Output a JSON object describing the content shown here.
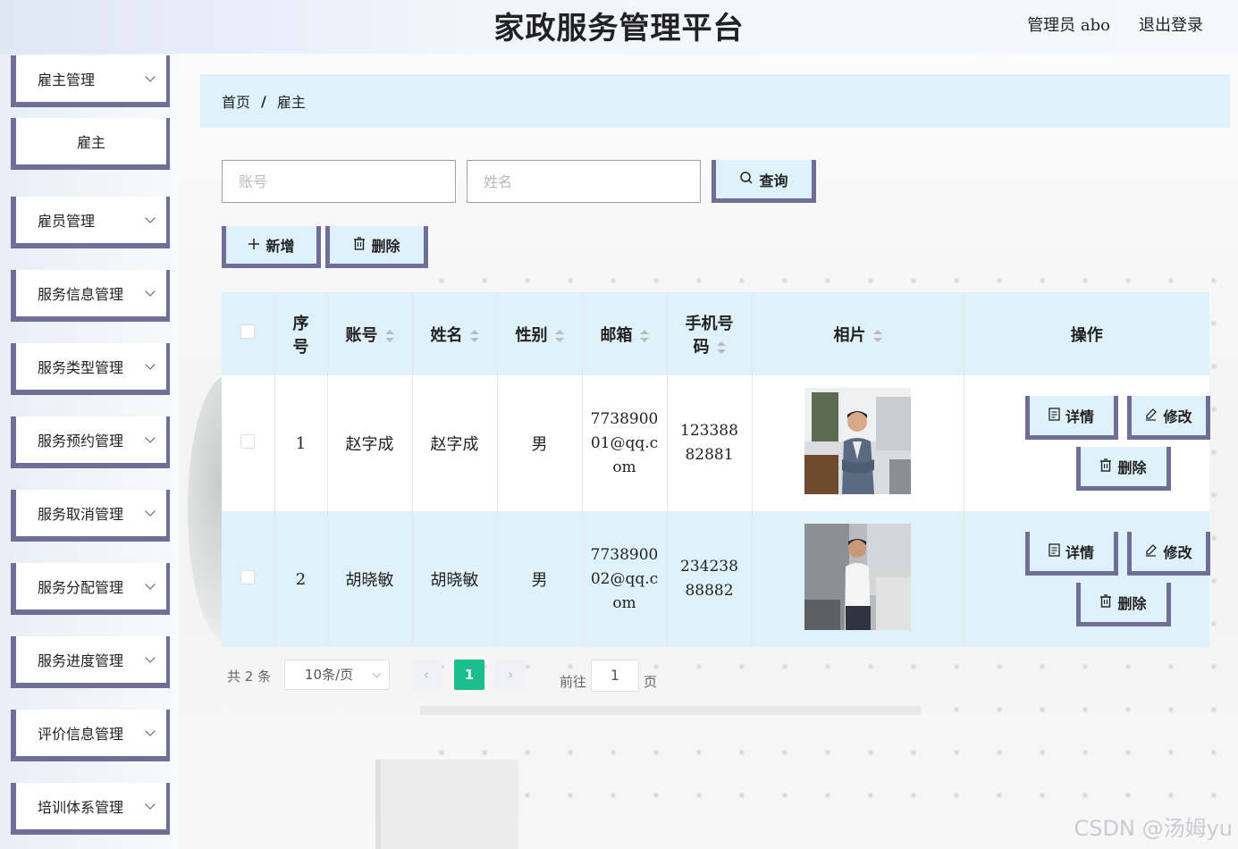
{
  "header": {
    "title": "家政服务管理平台",
    "admin": "管理员 abo",
    "logout": "退出登录"
  },
  "sidebar": {
    "items": [
      {
        "label": "雇主管理"
      },
      {
        "label": "雇主"
      },
      {
        "label": "雇员管理"
      },
      {
        "label": "服务信息管理"
      },
      {
        "label": "服务类型管理"
      },
      {
        "label": "服务预约管理"
      },
      {
        "label": "服务取消管理"
      },
      {
        "label": "服务分配管理"
      },
      {
        "label": "服务进度管理"
      },
      {
        "label": "评价信息管理"
      },
      {
        "label": "培训体系管理"
      }
    ]
  },
  "breadcrumb": {
    "home": "首页",
    "sep": "/",
    "current": "雇主"
  },
  "search": {
    "account_placeholder": "账号",
    "name_placeholder": "姓名",
    "query_label": "查询"
  },
  "toolbar": {
    "add_label": "新增",
    "delete_label": "删除"
  },
  "table": {
    "headers": {
      "index_line1": "序",
      "index_line2": "号",
      "account": "账号",
      "name": "姓名",
      "gender": "性别",
      "email": "邮箱",
      "phone_line1": "手机号",
      "phone_line2": "码",
      "photo": "相片",
      "ops": "操作"
    },
    "rows": [
      {
        "index": "1",
        "account": "赵字成",
        "name": "赵字成",
        "gender": "男",
        "email": "773890001@qq.com",
        "phone": "12338882881",
        "photo_icon": "person-in-suit-photo"
      },
      {
        "index": "2",
        "account": "胡晓敏",
        "name": "胡晓敏",
        "gender": "男",
        "email": "773890002@qq.com",
        "phone": "23423888882",
        "photo_icon": "person-in-white-shirt-photo"
      }
    ],
    "row_actions": {
      "detail": "详情",
      "edit": "修改",
      "delete": "删除"
    }
  },
  "pagination": {
    "total": "共 2 条",
    "page_size": "10条/页",
    "current_page": "1",
    "goto_prefix": "前往",
    "goto_value": "1",
    "goto_suffix": "页"
  },
  "watermark": "CSDN @汤姆yu",
  "colors": {
    "accent_border": "#6f6e97",
    "light_blue": "#dff1fb",
    "current_page": "#1bbe8d"
  }
}
